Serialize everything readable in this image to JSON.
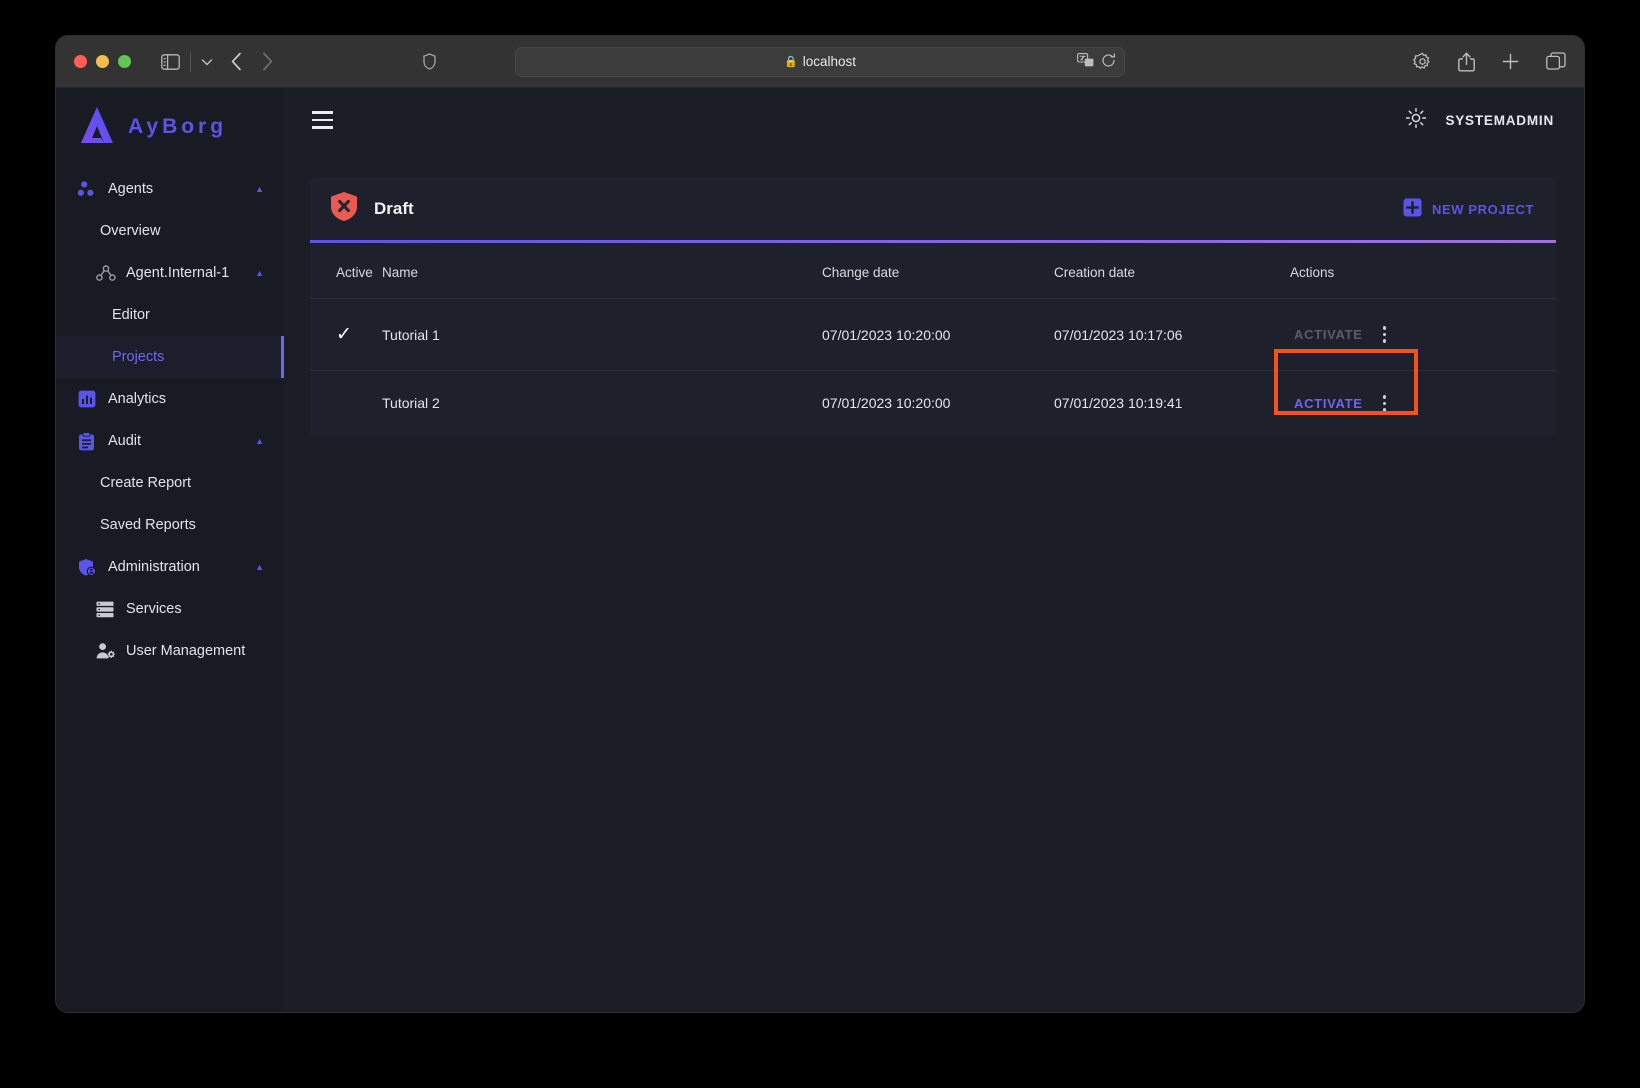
{
  "browser": {
    "url": "localhost",
    "lock_icon": "lock-icon",
    "traffic_lights": [
      "close-red",
      "minimize-yellow",
      "maximize-green"
    ],
    "toolbar_icons": [
      "sidebar-toggle-icon",
      "tab-overview-chevron-icon",
      "back-arrow-icon",
      "forward-arrow-icon",
      "privacy-shield-icon",
      "translate-icon",
      "reload-icon",
      "gear-icon",
      "share-icon",
      "new-tab-plus-icon",
      "tab-overview-icon"
    ]
  },
  "app": {
    "brand": "AyBorg",
    "brand_color": "#5b54e8",
    "logo_icon": "ayborg-logo-icon",
    "menu_icon": "hamburger-menu-icon",
    "theme_icon": "sun-light-mode-icon",
    "username": "SYSTEMADMIN"
  },
  "sidebar": {
    "items": [
      {
        "label": "Agents",
        "icon": "agents-dots-icon",
        "level": 0,
        "expanded": true,
        "active": false
      },
      {
        "label": "Overview",
        "icon": "",
        "level": 1,
        "expanded": null,
        "active": false
      },
      {
        "label": "Agent.Internal-1",
        "icon": "agent-node-icon",
        "level": 1,
        "expanded": true,
        "active": false
      },
      {
        "label": "Editor",
        "icon": "",
        "level": 2,
        "expanded": null,
        "active": false
      },
      {
        "label": "Projects",
        "icon": "",
        "level": 2,
        "expanded": null,
        "active": true
      },
      {
        "label": "Analytics",
        "icon": "analytics-chart-icon",
        "level": 0,
        "expanded": null,
        "active": false
      },
      {
        "label": "Audit",
        "icon": "audit-clipboard-icon",
        "level": 0,
        "expanded": true,
        "active": false
      },
      {
        "label": "Create Report",
        "icon": "",
        "level": 1,
        "expanded": null,
        "active": false
      },
      {
        "label": "Saved Reports",
        "icon": "",
        "level": 1,
        "expanded": null,
        "active": false
      },
      {
        "label": "Administration",
        "icon": "admin-shield-user-icon",
        "level": 0,
        "expanded": true,
        "active": false
      },
      {
        "label": "Services",
        "icon": "services-list-icon",
        "level": 1,
        "expanded": null,
        "active": false
      },
      {
        "label": "User Management",
        "icon": "user-management-icon",
        "level": 1,
        "expanded": null,
        "active": false
      }
    ]
  },
  "page": {
    "status_icon": "shield-x-draft-icon",
    "status_icon_color": "#eb5a52",
    "title": "Draft",
    "new_project_label": "NEW PROJECT",
    "new_project_icon": "plus-box-icon",
    "accent": "#5b54e8"
  },
  "table": {
    "columns": [
      "Active",
      "Name",
      "Change date",
      "Creation date",
      "Actions"
    ],
    "rows": [
      {
        "active": true,
        "active_icon": "checkmark-icon",
        "name": "Tutorial 1",
        "change_date": "07/01/2023 10:20:00",
        "creation_date": "07/01/2023 10:17:06",
        "activate_label": "ACTIVATE",
        "activate_enabled": false,
        "menu_icon": "kebab-menu-icon",
        "highlighted": false
      },
      {
        "active": false,
        "active_icon": "",
        "name": "Tutorial 2",
        "change_date": "07/01/2023 10:20:00",
        "creation_date": "07/01/2023 10:19:41",
        "activate_label": "ACTIVATE",
        "activate_enabled": true,
        "menu_icon": "kebab-menu-icon",
        "highlighted": true,
        "highlight_color": "#f4511e"
      }
    ]
  }
}
